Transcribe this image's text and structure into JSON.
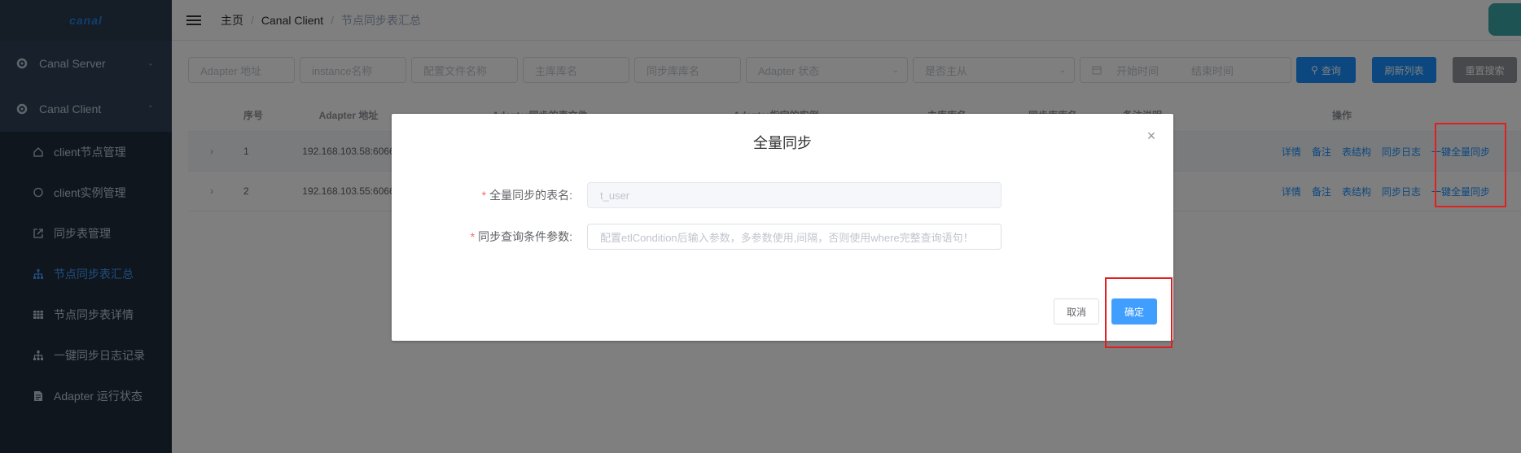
{
  "sidebar": {
    "logo": "canal",
    "items": [
      {
        "label": "Canal Server",
        "expanded": false
      },
      {
        "label": "Canal Client",
        "expanded": true
      }
    ],
    "sub_items": [
      {
        "label": "client节点管理",
        "icon": "home-icon"
      },
      {
        "label": "client实例管理",
        "icon": "chat-icon"
      },
      {
        "label": "同步表管理",
        "icon": "external-link-icon"
      },
      {
        "label": "节点同步表汇总",
        "icon": "tree-icon",
        "active": true
      },
      {
        "label": "节点同步表详情",
        "icon": "table-icon"
      },
      {
        "label": "一键同步日志记录",
        "icon": "tree-icon"
      },
      {
        "label": "Adapter 运行状态",
        "icon": "document-icon"
      }
    ]
  },
  "header": {
    "breadcrumb": [
      "主页",
      "Canal Client",
      "节点同步表汇总"
    ]
  },
  "filters": {
    "adapter_addr": "Adapter 地址",
    "instance": "instance名称",
    "config_file": "配置文件名称",
    "main_db": "主库库名",
    "sync_db": "同步库库名",
    "adapter_status": "Adapter 状态",
    "is_master": "是否主从",
    "start_time": "开始时间",
    "end_time": "结束时间",
    "query_btn": "查询",
    "refresh_btn": "刷新列表",
    "reset_btn": "重置搜索"
  },
  "table": {
    "headers": [
      "序号",
      "Adapter 地址",
      "Adapter同步的表文件",
      "Adapter指定的实例",
      "主库库名",
      "同步库库名",
      "备注说明",
      "操作"
    ],
    "rows": [
      {
        "index": "1",
        "address": "192.168.103.58:6066"
      },
      {
        "index": "2",
        "address": "192.168.103.55:6066"
      }
    ],
    "ops": [
      "详情",
      "备注",
      "表结构",
      "同步日志",
      "一键全量同步"
    ]
  },
  "dialog": {
    "title": "全量同步",
    "table_label": "全量同步的表名:",
    "table_value": "t_user",
    "cond_label": "同步查询条件参数:",
    "cond_placeholder": "配置etlCondition后输入参数，多参数使用,间隔，否则使用where完整查询语句！",
    "cancel": "取消",
    "ok": "确定",
    "required_mark": "*"
  },
  "colors": {
    "sidebar_bg": "#304156",
    "primary": "#409eff",
    "highlight": "#e02020"
  }
}
